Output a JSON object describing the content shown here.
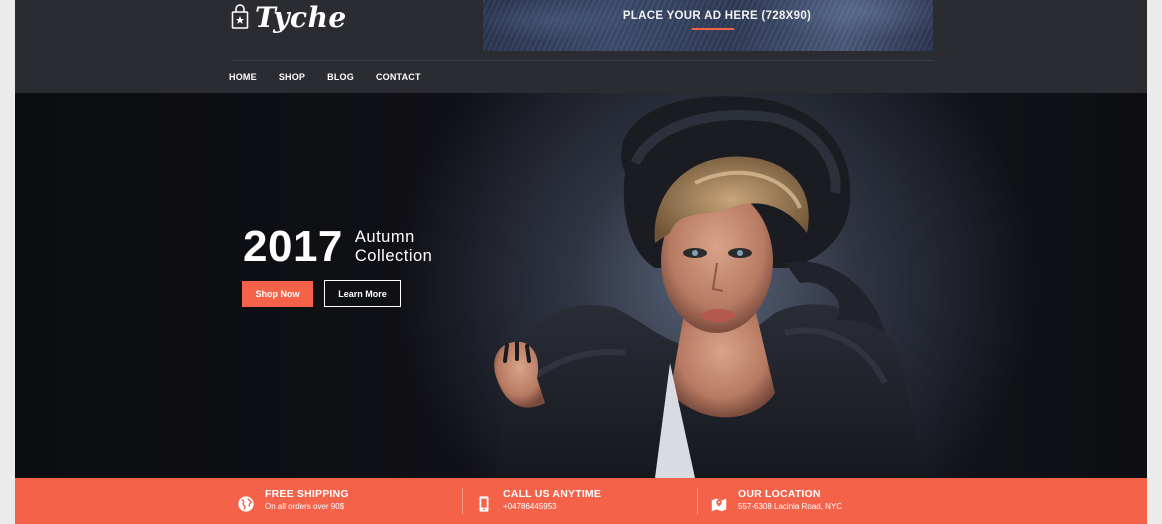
{
  "brand": {
    "name": "Tyche"
  },
  "ad": {
    "text": "PLACE YOUR AD HERE (728X90)"
  },
  "nav": {
    "items": [
      {
        "label": "HOME"
      },
      {
        "label": "SHOP"
      },
      {
        "label": "BLOG"
      },
      {
        "label": "CONTACT"
      }
    ]
  },
  "hero": {
    "year": "2017",
    "line1": "Autumn",
    "line2": "Collection",
    "primary_button": "Shop Now",
    "secondary_button": "Learn More"
  },
  "features": [
    {
      "title": "FREE SHIPPING",
      "subtitle": "On all orders over 90$",
      "icon": "globe-icon"
    },
    {
      "title": "CALL US ANYTIME",
      "subtitle": "+04786445953",
      "icon": "phone-icon"
    },
    {
      "title": "OUR LOCATION",
      "subtitle": "557-6308 Lacinia Road, NYC",
      "icon": "map-icon"
    }
  ],
  "colors": {
    "accent": "#f4624a",
    "header_bg": "#2b2c31",
    "hero_bg": "#0e0f13",
    "page_bg": "#ebebeb"
  }
}
